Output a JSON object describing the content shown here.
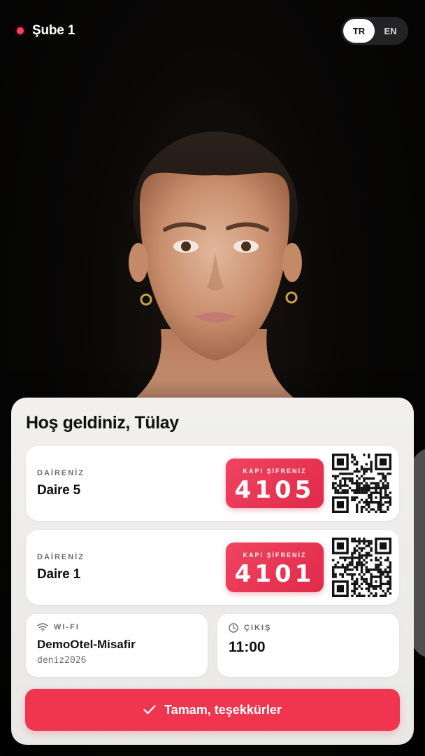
{
  "header": {
    "branch": "Şube 1",
    "live_color": "#ff3d5e",
    "languages": [
      {
        "code": "TR",
        "active": true
      },
      {
        "code": "EN",
        "active": false
      }
    ]
  },
  "welcome": {
    "greeting": "Hoş geldiniz, Tülay"
  },
  "rooms": [
    {
      "label": "DAİRENİZ",
      "name": "Daire 5",
      "code_label": "KAPI ŞİFRENİZ",
      "code": "4105",
      "qr_icon": "qr-code-icon"
    },
    {
      "label": "DAİRENİZ",
      "name": "Daire 1",
      "code_label": "KAPI ŞİFRENİZ",
      "code": "4101",
      "qr_icon": "qr-code-icon"
    }
  ],
  "wifi": {
    "label": "WI-FI",
    "icon": "wifi-icon",
    "network": "DemoOtel-Misafir",
    "password": "deniz2026"
  },
  "checkout": {
    "label": "ÇIKIŞ",
    "icon": "clock-icon",
    "time": "11:00"
  },
  "confirm": {
    "icon": "check-icon",
    "label": "Tamam, teşekkürler"
  },
  "colors": {
    "accent": "#f0354f",
    "code_badge": "#e8385a",
    "card_bg": "#efeeec"
  }
}
